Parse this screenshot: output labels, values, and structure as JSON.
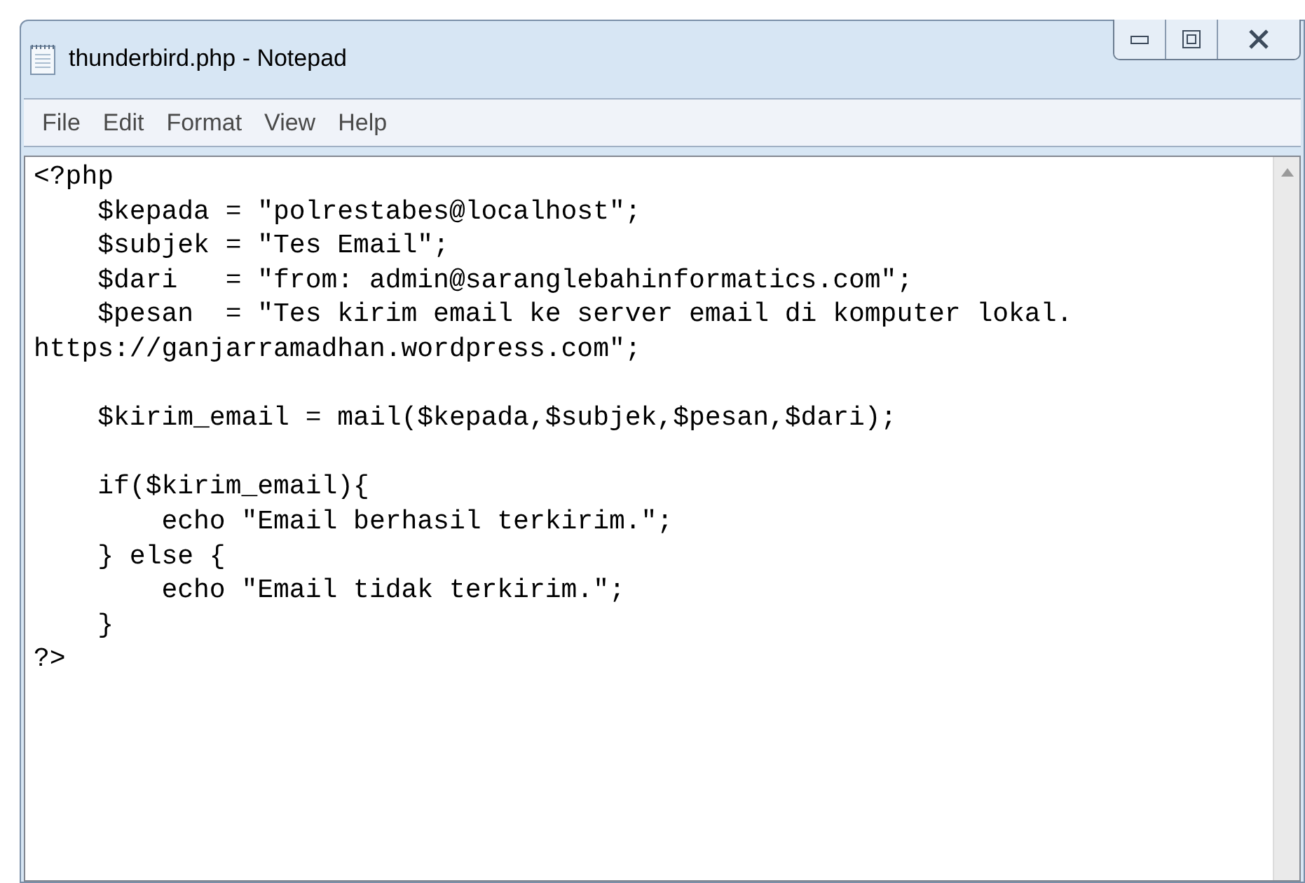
{
  "window": {
    "title": "thunderbird.php - Notepad"
  },
  "menu": [
    "File",
    "Edit",
    "Format",
    "View",
    "Help"
  ],
  "code_blocks": [
    [
      "<?php",
      "    $kepada = \"polrestabes@localhost\";",
      "    $subjek = \"Tes Email\";",
      "    $dari   = \"from: admin@saranglebahinformatics.com\";",
      "    $pesan  = \"Tes kirim email ke server email di komputer lokal.",
      "https://ganjarramadhan.wordpress.com\";"
    ],
    [
      "    $kirim_email = mail($kepada,$subjek,$pesan,$dari);"
    ],
    [
      "    if($kirim_email){",
      "        echo \"Email berhasil terkirim.\";",
      "    } else {",
      "        echo \"Email tidak terkirim.\";",
      "    }",
      "?>"
    ]
  ]
}
